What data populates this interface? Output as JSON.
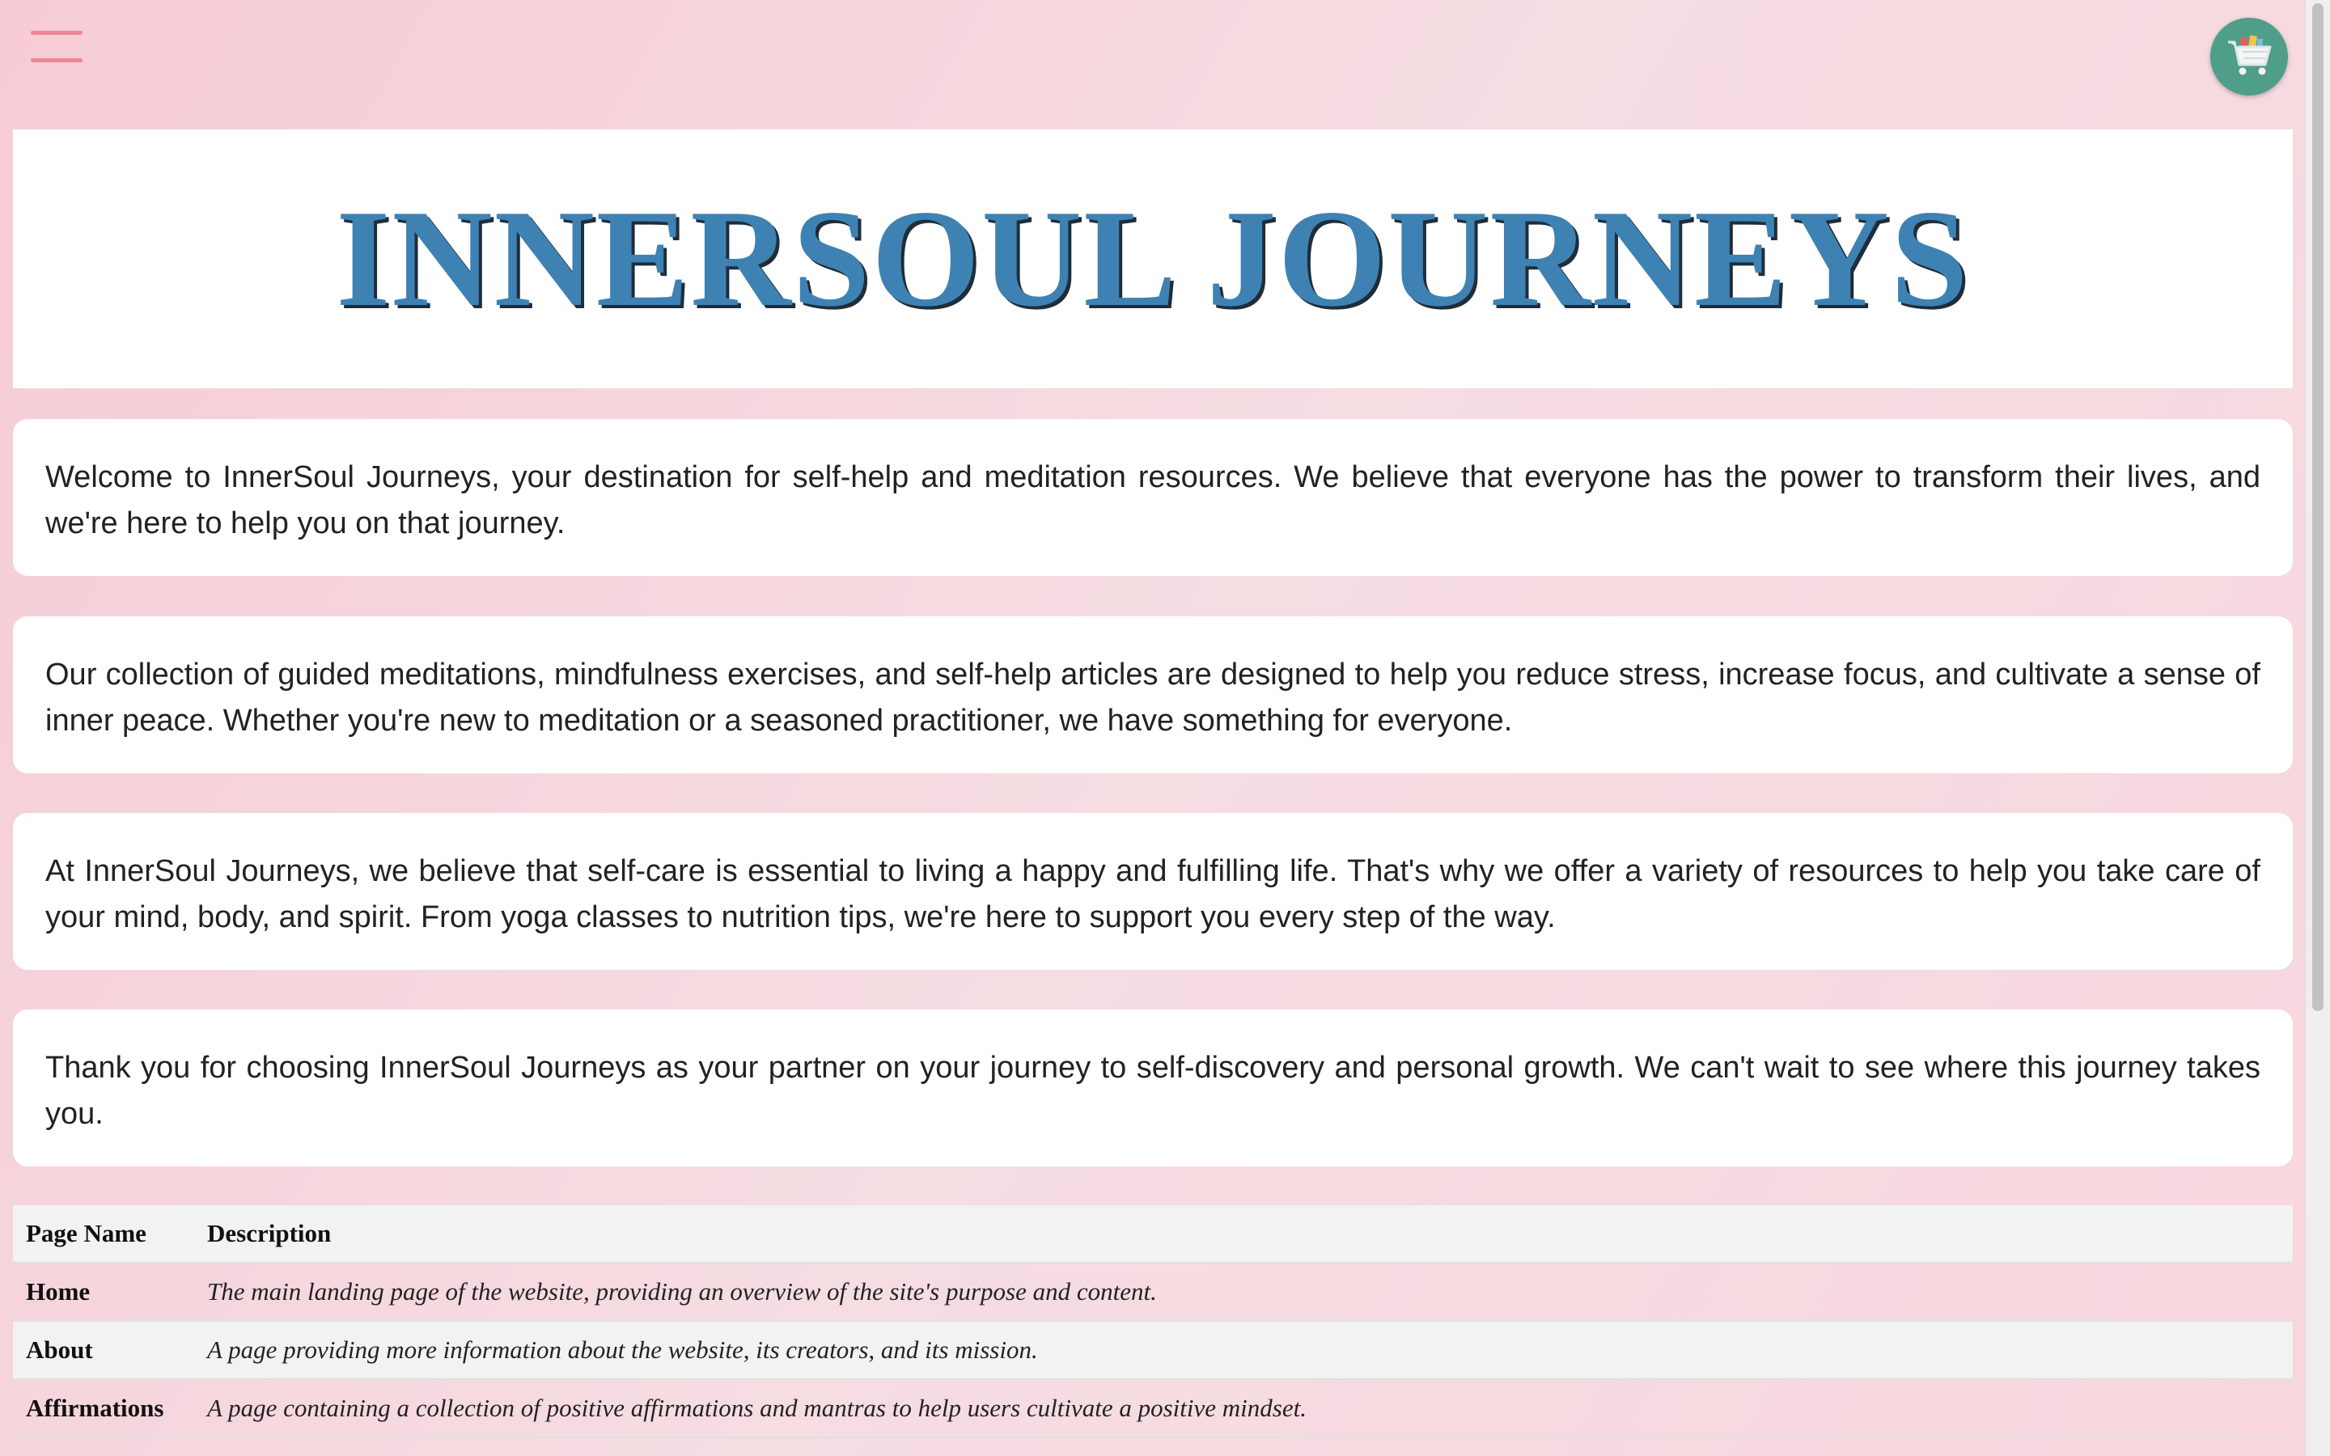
{
  "nav": {
    "menu_icon": "hamburger-menu-icon",
    "cart_icon": "shopping-cart-icon"
  },
  "header": {
    "title": "INNERSOUL JOURNEYS"
  },
  "paragraphs": [
    "Welcome to InnerSoul Journeys, your destination for self-help and meditation resources. We believe that everyone has the power to transform their lives, and we're here to help you on that journey.",
    "Our collection of guided meditations, mindfulness exercises, and self-help articles are designed to help you reduce stress, increase focus, and cultivate a sense of inner peace. Whether you're new to meditation or a seasoned practitioner, we have something for everyone.",
    "At InnerSoul Journeys, we believe that self-care is essential to living a happy and fulfilling life. That's why we offer a variety of resources to help you take care of your mind, body, and spirit. From yoga classes to nutrition tips, we're here to support you every step of the way.",
    "Thank you for choosing InnerSoul Journeys as your partner on your journey to self-discovery and personal growth. We can't wait to see where this journey takes you."
  ],
  "table": {
    "headers": [
      "Page Name",
      "Description"
    ],
    "rows": [
      {
        "name": "Home",
        "description": "The main landing page of the website, providing an overview of the site's purpose and content."
      },
      {
        "name": "About",
        "description": "A page providing more information about the website, its creators, and its mission."
      },
      {
        "name": "Affirmations",
        "description": "A page containing a collection of positive affirmations and mantras to help users cultivate a positive mindset."
      }
    ]
  },
  "colors": {
    "title": "#3e82b4",
    "menu": "#ef8598",
    "cart_bg": "#4e9e8a",
    "background": "#f5d8de"
  }
}
